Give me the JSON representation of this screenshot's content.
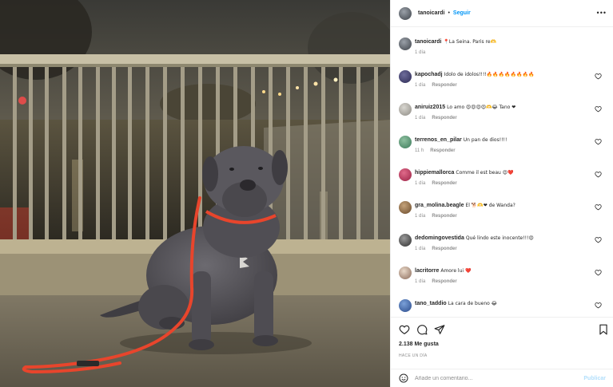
{
  "post": {
    "username": "tanoicardi",
    "dot": "•",
    "follow_label": "Seguir",
    "more_label": "•••"
  },
  "comments": [
    {
      "user": "tanoicardi",
      "text": "📍La Seina. Paris re🫶",
      "time": "1 día",
      "reply": ""
    },
    {
      "user": "kapochadj",
      "text": "Idolo de idolos!!!!🔥🔥🔥🔥🔥🔥🔥🔥",
      "time": "1 día",
      "reply": "Responder"
    },
    {
      "user": "aniruiz2015",
      "text": "Lo amo 😍😍😍😍🫶😂 Tano ❤",
      "time": "1 día",
      "reply": "Responder"
    },
    {
      "user": "terrenos_en_pilar",
      "text": "Un pan de dios!!!!",
      "time": "11 h",
      "reply": "Responder"
    },
    {
      "user": "hippiemallorca",
      "text": "Comme il est beau 😍❤️",
      "time": "1 día",
      "reply": "Responder"
    },
    {
      "user": "gra_molina.beagle",
      "text": "El 🐕🫶❤ de Wanda?",
      "time": "1 día",
      "reply": "Responder"
    },
    {
      "user": "dedomingovestida",
      "text": "Qué lindo este inocente!!!😍",
      "time": "1 día",
      "reply": "Responder"
    },
    {
      "user": "lacritorre",
      "text": "Amore lui ❤️",
      "time": "1 día",
      "reply": "Responder"
    },
    {
      "user": "tano_taddio",
      "text": "La cara de bueno 😂",
      "time": "",
      "reply": ""
    }
  ],
  "likes": "2.138 Me gusta",
  "time_ago": "HACE UN DÍA",
  "add_comment": {
    "placeholder": "Añade un comentario...",
    "publish": "Publicar"
  },
  "icons": {
    "heart": "heart-icon",
    "comment": "comment-icon",
    "share": "share-icon",
    "save": "bookmark-icon",
    "emoji": "emoji-icon"
  },
  "colors": {
    "link": "#0095f6",
    "publish_disabled": "#b2dffc",
    "leash": "#e8452c",
    "dog": "#56545a"
  }
}
